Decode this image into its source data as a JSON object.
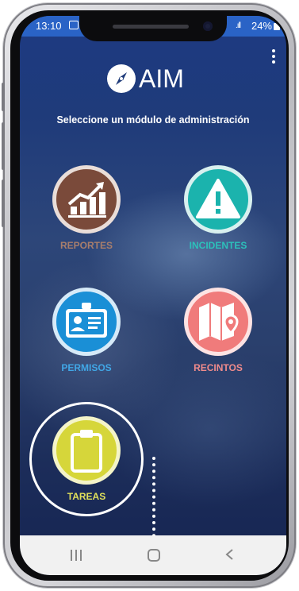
{
  "status_bar": {
    "time": "13:10",
    "battery": "24%",
    "signal": ".ıll"
  },
  "app": {
    "logo_text": "AIM",
    "subtitle": "Seleccione un módulo de administración"
  },
  "modules": {
    "reportes": {
      "label": "REPORTES",
      "icon": "bar-chart-trend-icon",
      "color": "#7a4a3a",
      "label_color": "#a87e6c"
    },
    "incidentes": {
      "label": "INCIDENTES",
      "icon": "warning-icon",
      "color": "#1bb3ad",
      "label_color": "#2cc1bb"
    },
    "permisos": {
      "label": "PERMISOS",
      "icon": "id-card-icon",
      "color": "#1a8fd6",
      "label_color": "#41a7e6"
    },
    "recintos": {
      "label": "RECINTOS",
      "icon": "map-pin-icon",
      "color": "#f07b7b",
      "label_color": "#f08b8b"
    },
    "tareas": {
      "label": "TAREAS",
      "icon": "clipboard-icon",
      "color": "#d6d63a",
      "label_color": "#e0e05a"
    }
  },
  "nav_bar": {
    "recents": "recents-icon",
    "home": "home-icon",
    "back": "back-icon"
  }
}
